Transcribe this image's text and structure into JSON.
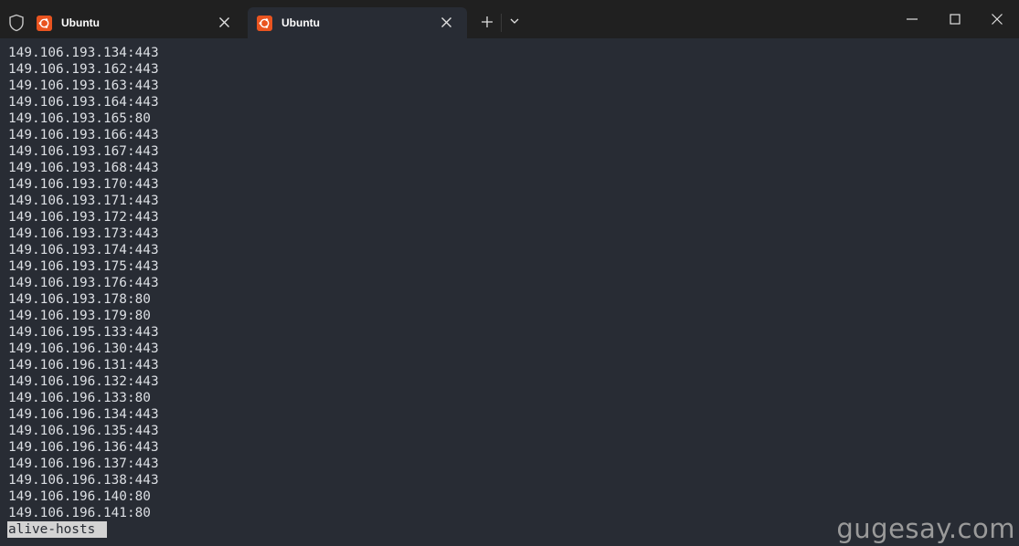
{
  "tabs": [
    {
      "label": "Ubuntu",
      "active": false
    },
    {
      "label": "Ubuntu",
      "active": true
    }
  ],
  "colors": {
    "titlebar": "#202020",
    "terminal_bg": "#282c34",
    "terminal_fg": "#dcdfe4",
    "ubuntu_orange": "#e95420"
  },
  "icons": {
    "shield": "shield-icon",
    "tab_app": "ubuntu-icon",
    "tab_close": "close-icon",
    "new_tab": "plus-icon",
    "dropdown": "chevron-down-icon",
    "minimize": "minimize-icon",
    "maximize": "maximize-icon",
    "window_close": "close-icon"
  },
  "terminal": {
    "lines": [
      "149.106.193.134:443",
      "149.106.193.162:443",
      "149.106.193.163:443",
      "149.106.193.164:443",
      "149.106.193.165:80",
      "149.106.193.166:443",
      "149.106.193.167:443",
      "149.106.193.168:443",
      "149.106.193.170:443",
      "149.106.193.171:443",
      "149.106.193.172:443",
      "149.106.193.173:443",
      "149.106.193.174:443",
      "149.106.193.175:443",
      "149.106.193.176:443",
      "149.106.193.178:80",
      "149.106.193.179:80",
      "149.106.195.133:443",
      "149.106.196.130:443",
      "149.106.196.131:443",
      "149.106.196.132:443",
      "149.106.196.133:80",
      "149.106.196.134:443",
      "149.106.196.135:443",
      "149.106.196.136:443",
      "149.106.196.137:443",
      "149.106.196.138:443",
      "149.106.196.140:80",
      "149.106.196.141:80"
    ],
    "pager_prompt": "alive-hosts "
  },
  "watermark": "gugesay.com"
}
